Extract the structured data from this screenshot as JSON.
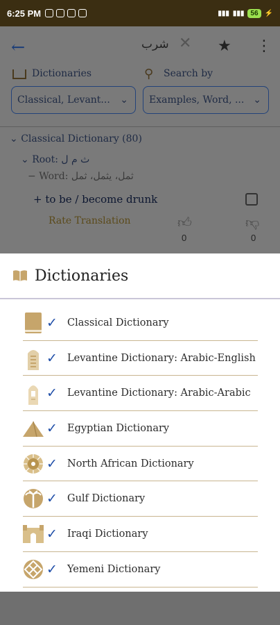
{
  "status_bar": {
    "time": "6:25 PM",
    "battery": "56"
  },
  "background": {
    "query": "شرب",
    "dictionaries_label": "Dictionaries",
    "search_by_label": "Search by",
    "dictionaries_select": "Classical, Levant...",
    "search_by_select": "Examples, Word, ...",
    "result_header": "Classical Dictionary (80)",
    "root_label": "Root: ث م ل",
    "word_label": "Word: ثمل، يثمل، ثمل",
    "translation": "to be / become drunk",
    "rate": "Rate Translation",
    "up_count": "0",
    "down_count": "0"
  },
  "sheet": {
    "title": "Dictionaries",
    "items": [
      {
        "label": "Classical Dictionary",
        "icon": "book-icon"
      },
      {
        "label": "Levantine Dictionary: Arabic-English",
        "icon": "tower-icon"
      },
      {
        "label": "Levantine Dictionary: Arabic-Arabic",
        "icon": "tower-icon"
      },
      {
        "label": "Egyptian Dictionary",
        "icon": "pyramid-icon"
      },
      {
        "label": "North African Dictionary",
        "icon": "sun-ornament-icon"
      },
      {
        "label": "Gulf Dictionary",
        "icon": "palm-tree-icon"
      },
      {
        "label": "Iraqi Dictionary",
        "icon": "gate-icon"
      },
      {
        "label": "Yemeni Dictionary",
        "icon": "pattern-icon"
      }
    ]
  },
  "colors": {
    "accent_gold": "#c6a56b",
    "check_blue": "#1f4ea8"
  }
}
